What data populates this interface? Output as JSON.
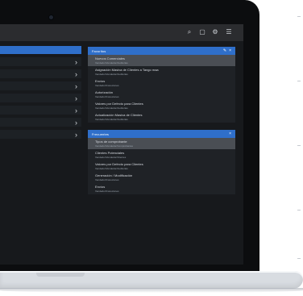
{
  "toolbar": {
    "icons": [
      "search-icon",
      "grid-icon",
      "gear-icon",
      "user-menu-icon"
    ]
  },
  "left_panel": {
    "rows": [
      {
        "chevron": "›"
      },
      {
        "chevron": "›"
      },
      {
        "chevron": "›"
      },
      {
        "chevron": "›"
      },
      {
        "chevron": "›"
      },
      {
        "chevron": "›"
      },
      {
        "chevron": "›"
      }
    ]
  },
  "favorites": {
    "title": "Favoritos",
    "items": [
      {
        "title": "Nuevos Comerciales",
        "subtitle": "Vendedor/Vendedor/Auditorias"
      },
      {
        "title": "Asignación Masiva de Clientes a Tango maa",
        "subtitle": "Vendedor/Vendedor/Auditorias"
      },
      {
        "title": "Envíos",
        "subtitle": "Vendedor/Conexiones"
      },
      {
        "title": "Autorización",
        "subtitle": "Vendedor/Conexiones"
      },
      {
        "title": "Valores por Defecto para Clientes",
        "subtitle": "Vendedor/Vendedor/Auditorias"
      },
      {
        "title": "Actualización Masiva de Clientes",
        "subtitle": "Vendedor/Vendedor/Auditorias"
      }
    ]
  },
  "frequent": {
    "title": "Frecuentes",
    "items": [
      {
        "title": "Tipos de comprobante",
        "subtitle": "Vendedor/Vendedor/Comprobantes"
      },
      {
        "title": "Clientes Potenciales",
        "subtitle": "Vendedor/Vendedor/Clientes"
      },
      {
        "title": "Valores por Defecto para Clientes",
        "subtitle": "Vendedor/Vendedor/Auditorias"
      },
      {
        "title": "Generación / Modificación",
        "subtitle": "Vendedor/Conexiones"
      },
      {
        "title": "Envíos",
        "subtitle": "Vendedor/Conexiones"
      }
    ]
  }
}
